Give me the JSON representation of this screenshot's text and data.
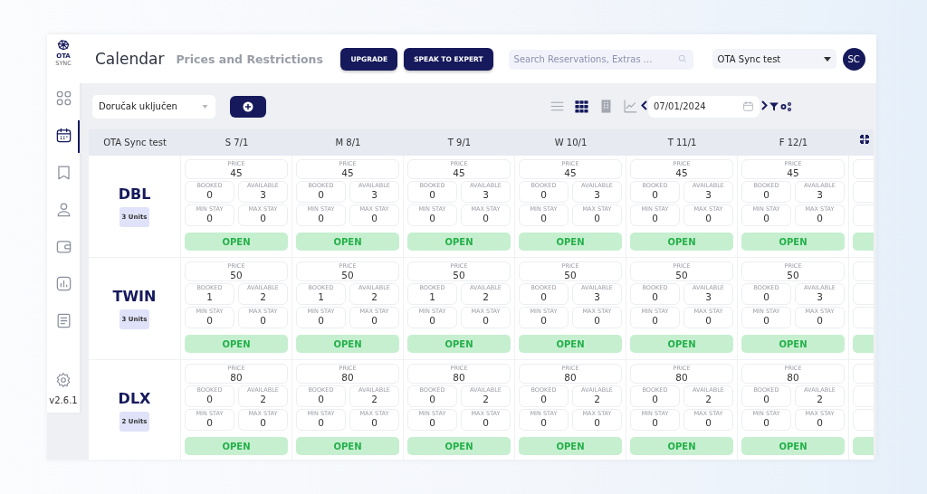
{
  "sidebar": {
    "logo": {
      "text": "OTA",
      "subtext": "SYNC"
    },
    "items": [
      {
        "selected": false
      },
      {
        "selected": true
      },
      {
        "selected": false
      },
      {
        "selected": false
      },
      {
        "selected": false
      },
      {
        "selected": false
      },
      {
        "selected": false
      }
    ],
    "version": "v2.6.1"
  },
  "header": {
    "title": "Calendar",
    "subtitle": "Prices and Restrictions",
    "buttons": [
      "UPGRADE",
      "SPEAK TO EXPERT"
    ],
    "search": {
      "placeholder": "Search Reservations, Extras ..."
    },
    "property_select": "OTA Sync test",
    "avatar": "SC"
  },
  "toolbar": {
    "rate_plan_select": "Doručak uključen",
    "views": [
      {
        "selected": false
      },
      {
        "selected": true
      },
      {
        "selected": false
      },
      {
        "selected": false
      }
    ],
    "date": "07/01/2024"
  },
  "calendar": {
    "corner": "OTA Sync test",
    "days": [
      "S 7/1",
      "M 8/1",
      "T 9/1",
      "W 10/1",
      "T 11/1",
      "F 12/1"
    ],
    "rooms": [
      {
        "name": "DBL",
        "units": "3 Units",
        "cells": [
          {
            "fields": [
              {
                "label": "PRICE",
                "value": "45"
              },
              {
                "label": "BOOKED",
                "value": "0"
              },
              {
                "label": "AVAILABLE",
                "value": "3"
              },
              {
                "label": "MIN STAY",
                "value": "0"
              },
              {
                "label": "MAX STAY",
                "value": "0"
              }
            ],
            "status": "OPEN"
          },
          {
            "fields": [
              {
                "label": "PRICE",
                "value": "45"
              },
              {
                "label": "BOOKED",
                "value": "0"
              },
              {
                "label": "AVAILABLE",
                "value": "3"
              },
              {
                "label": "MIN STAY",
                "value": "0"
              },
              {
                "label": "MAX STAY",
                "value": "0"
              }
            ],
            "status": "OPEN"
          },
          {
            "fields": [
              {
                "label": "PRICE",
                "value": "45"
              },
              {
                "label": "BOOKED",
                "value": "0"
              },
              {
                "label": "AVAILABLE",
                "value": "3"
              },
              {
                "label": "MIN STAY",
                "value": "0"
              },
              {
                "label": "MAX STAY",
                "value": "0"
              }
            ],
            "status": "OPEN"
          },
          {
            "fields": [
              {
                "label": "PRICE",
                "value": "45"
              },
              {
                "label": "BOOKED",
                "value": "0"
              },
              {
                "label": "AVAILABLE",
                "value": "3"
              },
              {
                "label": "MIN STAY",
                "value": "0"
              },
              {
                "label": "MAX STAY",
                "value": "0"
              }
            ],
            "status": "OPEN"
          },
          {
            "fields": [
              {
                "label": "PRICE",
                "value": "45"
              },
              {
                "label": "BOOKED",
                "value": "0"
              },
              {
                "label": "AVAILABLE",
                "value": "3"
              },
              {
                "label": "MIN STAY",
                "value": "0"
              },
              {
                "label": "MAX STAY",
                "value": "0"
              }
            ],
            "status": "OPEN"
          },
          {
            "fields": [
              {
                "label": "PRICE",
                "value": "45"
              },
              {
                "label": "BOOKED",
                "value": "0"
              },
              {
                "label": "AVAILABLE",
                "value": "3"
              },
              {
                "label": "MIN STAY",
                "value": "0"
              },
              {
                "label": "MAX STAY",
                "value": "0"
              }
            ],
            "status": "OPEN"
          }
        ]
      },
      {
        "name": "TWIN",
        "units": "3 Units",
        "cells": [
          {
            "fields": [
              {
                "label": "PRICE",
                "value": "50"
              },
              {
                "label": "BOOKED",
                "value": "1"
              },
              {
                "label": "AVAILABLE",
                "value": "2"
              },
              {
                "label": "MIN STAY",
                "value": "0"
              },
              {
                "label": "MAX STAY",
                "value": "0"
              }
            ],
            "status": "OPEN"
          },
          {
            "fields": [
              {
                "label": "PRICE",
                "value": "50"
              },
              {
                "label": "BOOKED",
                "value": "1"
              },
              {
                "label": "AVAILABLE",
                "value": "2"
              },
              {
                "label": "MIN STAY",
                "value": "0"
              },
              {
                "label": "MAX STAY",
                "value": "0"
              }
            ],
            "status": "OPEN"
          },
          {
            "fields": [
              {
                "label": "PRICE",
                "value": "50"
              },
              {
                "label": "BOOKED",
                "value": "1"
              },
              {
                "label": "AVAILABLE",
                "value": "2"
              },
              {
                "label": "MIN STAY",
                "value": "0"
              },
              {
                "label": "MAX STAY",
                "value": "0"
              }
            ],
            "status": "OPEN"
          },
          {
            "fields": [
              {
                "label": "PRICE",
                "value": "50"
              },
              {
                "label": "BOOKED",
                "value": "0"
              },
              {
                "label": "AVAILABLE",
                "value": "3"
              },
              {
                "label": "MIN STAY",
                "value": "0"
              },
              {
                "label": "MAX STAY",
                "value": "0"
              }
            ],
            "status": "OPEN"
          },
          {
            "fields": [
              {
                "label": "PRICE",
                "value": "50"
              },
              {
                "label": "BOOKED",
                "value": "0"
              },
              {
                "label": "AVAILABLE",
                "value": "3"
              },
              {
                "label": "MIN STAY",
                "value": "0"
              },
              {
                "label": "MAX STAY",
                "value": "0"
              }
            ],
            "status": "OPEN"
          },
          {
            "fields": [
              {
                "label": "PRICE",
                "value": "50"
              },
              {
                "label": "BOOKED",
                "value": "0"
              },
              {
                "label": "AVAILABLE",
                "value": "3"
              },
              {
                "label": "MIN STAY",
                "value": "0"
              },
              {
                "label": "MAX STAY",
                "value": "0"
              }
            ],
            "status": "OPEN"
          }
        ]
      },
      {
        "name": "DLX",
        "units": "2 Units",
        "cells": [
          {
            "fields": [
              {
                "label": "PRICE",
                "value": "80"
              },
              {
                "label": "BOOKED",
                "value": "0"
              },
              {
                "label": "AVAILABLE",
                "value": "2"
              },
              {
                "label": "MIN STAY",
                "value": "0"
              },
              {
                "label": "MAX STAY",
                "value": "0"
              }
            ],
            "status": "OPEN"
          },
          {
            "fields": [
              {
                "label": "PRICE",
                "value": "80"
              },
              {
                "label": "BOOKED",
                "value": "0"
              },
              {
                "label": "AVAILABLE",
                "value": "2"
              },
              {
                "label": "MIN STAY",
                "value": "0"
              },
              {
                "label": "MAX STAY",
                "value": "0"
              }
            ],
            "status": "OPEN"
          },
          {
            "fields": [
              {
                "label": "PRICE",
                "value": "80"
              },
              {
                "label": "BOOKED",
                "value": "0"
              },
              {
                "label": "AVAILABLE",
                "value": "2"
              },
              {
                "label": "MIN STAY",
                "value": "0"
              },
              {
                "label": "MAX STAY",
                "value": "0"
              }
            ],
            "status": "OPEN"
          },
          {
            "fields": [
              {
                "label": "PRICE",
                "value": "80"
              },
              {
                "label": "BOOKED",
                "value": "0"
              },
              {
                "label": "AVAILABLE",
                "value": "2"
              },
              {
                "label": "MIN STAY",
                "value": "0"
              },
              {
                "label": "MAX STAY",
                "value": "0"
              }
            ],
            "status": "OPEN"
          },
          {
            "fields": [
              {
                "label": "PRICE",
                "value": "80"
              },
              {
                "label": "BOOKED",
                "value": "0"
              },
              {
                "label": "AVAILABLE",
                "value": "2"
              },
              {
                "label": "MIN STAY",
                "value": "0"
              },
              {
                "label": "MAX STAY",
                "value": "0"
              }
            ],
            "status": "OPEN"
          },
          {
            "fields": [
              {
                "label": "PRICE",
                "value": "80"
              },
              {
                "label": "BOOKED",
                "value": "0"
              },
              {
                "label": "AVAILABLE",
                "value": "2"
              },
              {
                "label": "MIN STAY",
                "value": "0"
              },
              {
                "label": "MAX STAY",
                "value": "0"
              }
            ],
            "status": "OPEN"
          }
        ]
      }
    ]
  }
}
